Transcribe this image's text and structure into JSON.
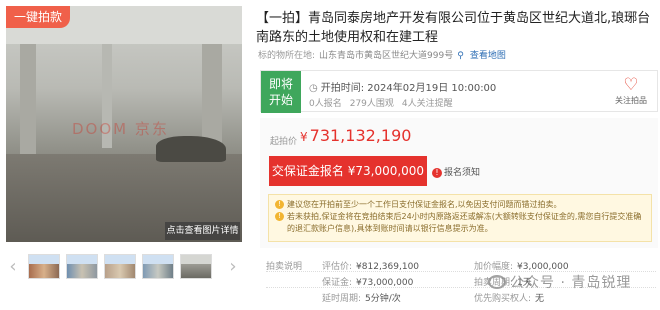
{
  "gallery": {
    "badge_label": "一键拍款",
    "photo_watermark": "DOOM 京东",
    "detail_button": "点击查看图片详情",
    "prev_arrow": "‹",
    "next_arrow": "›",
    "thumb_count": 5
  },
  "title": "【一拍】青岛同泰房地产开发有限公司位于黄岛区世纪大道北,琅琊台南路东的土地使用权和在建工程",
  "address": {
    "label": "标的物所在地:",
    "value": "山东青岛市黄岛区世纪大道999号",
    "map_link": "查看地图"
  },
  "status": {
    "tag": "即将开始",
    "start_label": "开拍时间:",
    "start_value": "2024年02月19日 10:00:00",
    "bidders": "0人报名",
    "views": "279人围观",
    "reminders": "4人关注提醒",
    "follow_label": "关注拍品"
  },
  "price": {
    "start_label": "起拍价",
    "currency": "¥",
    "start_value": "731,132,190",
    "deposit_button": "交保证金报名 ¥73,000,000",
    "notice_link": "报名须知"
  },
  "tips": [
    "建议您在开拍前至少一个工作日支付保证金报名,以免因支付问题而错过拍卖。",
    "若未获拍,保证金将在竞拍结束后24小时内原路返还或解冻(大额转账支付保证金的,需您自行提交准确的退汇款账户信息),具体到账时间请以银行信息提示为准。"
  ],
  "params": {
    "section_label": "拍卖说明",
    "appraisal_label": "评估价:",
    "appraisal_value": "¥812,369,100",
    "increment_label": "加价幅度:",
    "increment_value": "¥3,000,000",
    "deposit_label": "保证金:",
    "deposit_value": "¥73,000,000",
    "cycle_label": "拍卖周期:",
    "cycle_value": "1天",
    "delay_label": "延时周期:",
    "delay_value": "5分钟/次",
    "priority_label": "优先购买权人:",
    "priority_value": "无"
  },
  "watermark_text": "公众号 · 青岛锐理"
}
